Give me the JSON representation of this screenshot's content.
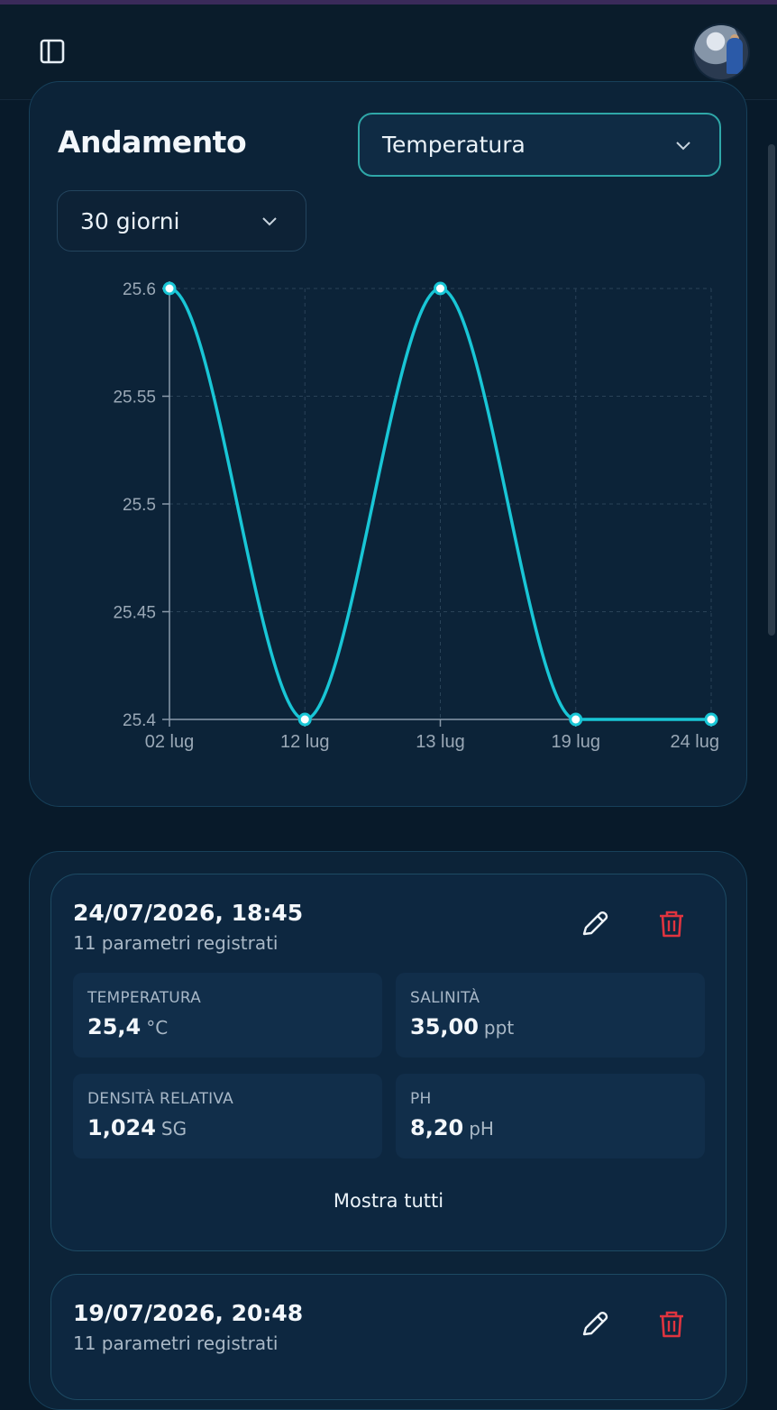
{
  "header": {
    "sidebar_icon": "sidebar-toggle-icon",
    "avatar_icon": "user-avatar"
  },
  "chart_card": {
    "title": "Andamento",
    "parameter_select": {
      "value": "Temperatura"
    },
    "range_select": {
      "value": "30 giorni"
    }
  },
  "chart_data": {
    "type": "line",
    "categories": [
      "02 lug",
      "12 lug",
      "13 lug",
      "19 lug",
      "24 lug"
    ],
    "series": [
      {
        "values": [
          25.6,
          25.4,
          25.6,
          25.4,
          25.4
        ]
      }
    ],
    "y_ticks": [
      "25.6",
      "25.55",
      "25.5",
      "25.45",
      "25.4"
    ],
    "ylim": [
      25.4,
      25.6
    ],
    "xlabel": "",
    "ylabel": "",
    "grid": true,
    "line_color": "#19c6d6"
  },
  "entries": [
    {
      "date": "24/07/2026, 18:45",
      "subtitle": "11 parametri registrati",
      "params": [
        {
          "label": "TEMPERATURA",
          "value": "25,4",
          "unit": "°C"
        },
        {
          "label": "SALINITÀ",
          "value": "35,00",
          "unit": "ppt"
        },
        {
          "label": "DENSITÀ RELATIVA",
          "value": "1,024",
          "unit": "SG"
        },
        {
          "label": "PH",
          "value": "8,20",
          "unit": "pH"
        }
      ],
      "show_all": "Mostra tutti"
    },
    {
      "date": "19/07/2026, 20:48",
      "subtitle": "11 parametri registrati"
    }
  ],
  "colors": {
    "accent": "#19c6d6",
    "delete": "#e0343f",
    "background": "#081a2a",
    "card": "#0c2338"
  },
  "icons": {
    "edit": "pencil-icon",
    "delete": "trash-icon",
    "chevron": "chevron-down-icon"
  }
}
